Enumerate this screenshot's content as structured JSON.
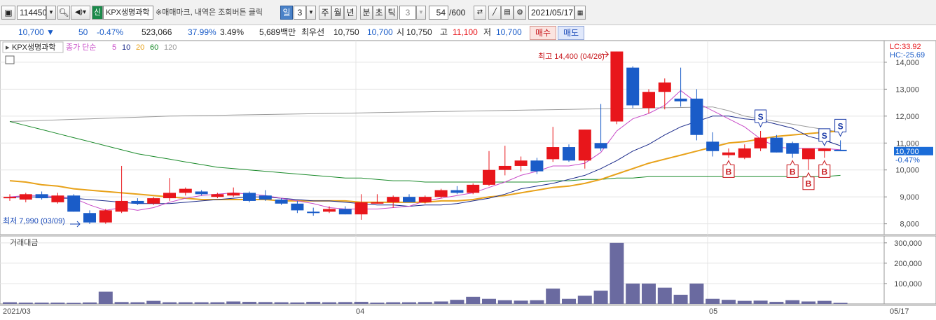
{
  "toolbar": {
    "code": "114450",
    "stock_badge": "신",
    "stock_name": "KPX생명과학",
    "notice": "※매매마크, 내역은 조회버튼 클릭",
    "period_selected": "일",
    "period_value": "3",
    "periods": [
      "주",
      "월",
      "년",
      "분",
      "초",
      "틱"
    ],
    "tick_value": "3",
    "count_value": "54",
    "count_total": "/600",
    "date": "2021/05/17"
  },
  "info": {
    "price": "10,700",
    "price_arrow": "▼",
    "change": "50",
    "change_pct": "-0.47%",
    "volume": "523,066",
    "vol_ratio": "37.99%",
    "turnover_pct": "3.49%",
    "amount": "5,689백만",
    "best_ask_label": "최우선",
    "best_ask": "10,750",
    "best_bid": "10,700",
    "open_label": "시",
    "open": "10,750",
    "high_label": "고",
    "high": "11,100",
    "low_label": "저",
    "low": "10,700",
    "buy_label": "매수",
    "sell_label": "매도"
  },
  "chart_labels": {
    "title": "KPX생명과학",
    "ma_label": "종가 단순",
    "ma_periods": [
      "5",
      "10",
      "20",
      "60",
      "120"
    ],
    "lc": "LC:33.92",
    "hc": "HC:-25.69",
    "high_marker": "최고 14,400 (04/26)",
    "low_marker": "최저 7,990 (03/09)",
    "last_price": "10,700",
    "last_change": "-0.47%",
    "volume_title": "거래대금"
  },
  "colors": {
    "up": "#e8161b",
    "down": "#1a5cc8",
    "ma5": "#c84bc8",
    "ma10": "#1a2a8a",
    "ma20": "#e8a21a",
    "ma60": "#1a8a2a",
    "ma120": "#9a9a9a",
    "volume": "#6a6aa0"
  },
  "chart_data": {
    "type": "candlestick",
    "ylim": [
      7600,
      14700
    ],
    "y_ticks": [
      "14,000",
      "13,000",
      "12,000",
      "11,000",
      "10,000",
      "9,000",
      "8,000"
    ],
    "y_tick_values": [
      14000,
      13000,
      12000,
      11000,
      10000,
      9000,
      8000
    ],
    "x_labels": [
      "2021/03",
      "04",
      "05",
      "05/17"
    ],
    "candles": [
      {
        "o": 8950,
        "h": 9100,
        "l": 8850,
        "c": 9000
      },
      {
        "o": 8900,
        "h": 9150,
        "l": 8800,
        "c": 9100
      },
      {
        "o": 9100,
        "h": 9200,
        "l": 8900,
        "c": 8950
      },
      {
        "o": 8800,
        "h": 9150,
        "l": 8750,
        "c": 9050
      },
      {
        "o": 9050,
        "h": 9100,
        "l": 8450,
        "c": 8450
      },
      {
        "o": 8400,
        "h": 8500,
        "l": 7990,
        "c": 8050
      },
      {
        "o": 8050,
        "h": 8550,
        "l": 8000,
        "c": 8500
      },
      {
        "o": 8450,
        "h": 10150,
        "l": 8400,
        "c": 8850
      },
      {
        "o": 8850,
        "h": 8950,
        "l": 8700,
        "c": 8750
      },
      {
        "o": 8750,
        "h": 9000,
        "l": 8700,
        "c": 8950
      },
      {
        "o": 8950,
        "h": 9700,
        "l": 8850,
        "c": 9150
      },
      {
        "o": 9150,
        "h": 9350,
        "l": 9050,
        "c": 9300
      },
      {
        "o": 9200,
        "h": 9250,
        "l": 9050,
        "c": 9100
      },
      {
        "o": 9000,
        "h": 9150,
        "l": 8950,
        "c": 9100
      },
      {
        "o": 9050,
        "h": 9350,
        "l": 9000,
        "c": 9150
      },
      {
        "o": 9150,
        "h": 9200,
        "l": 8800,
        "c": 8850
      },
      {
        "o": 9050,
        "h": 9250,
        "l": 8850,
        "c": 8900
      },
      {
        "o": 8900,
        "h": 8950,
        "l": 8700,
        "c": 8750
      },
      {
        "o": 8750,
        "h": 8850,
        "l": 8400,
        "c": 8500
      },
      {
        "o": 8450,
        "h": 8600,
        "l": 8300,
        "c": 8400
      },
      {
        "o": 8450,
        "h": 8650,
        "l": 8400,
        "c": 8550
      },
      {
        "o": 8550,
        "h": 8650,
        "l": 8350,
        "c": 8350
      },
      {
        "o": 8350,
        "h": 9100,
        "l": 8150,
        "c": 8800
      },
      {
        "o": 8800,
        "h": 9100,
        "l": 8750,
        "c": 8800
      },
      {
        "o": 8800,
        "h": 9050,
        "l": 8600,
        "c": 9000
      },
      {
        "o": 9000,
        "h": 9100,
        "l": 8800,
        "c": 8800
      },
      {
        "o": 8800,
        "h": 9050,
        "l": 8750,
        "c": 9000
      },
      {
        "o": 9000,
        "h": 9300,
        "l": 8950,
        "c": 9250
      },
      {
        "o": 9250,
        "h": 9400,
        "l": 9100,
        "c": 9150
      },
      {
        "o": 9150,
        "h": 9500,
        "l": 9100,
        "c": 9450
      },
      {
        "o": 9450,
        "h": 10700,
        "l": 9400,
        "c": 10000
      },
      {
        "o": 10000,
        "h": 10900,
        "l": 9800,
        "c": 10150
      },
      {
        "o": 10150,
        "h": 10500,
        "l": 9950,
        "c": 10350
      },
      {
        "o": 10350,
        "h": 10450,
        "l": 9850,
        "c": 9950
      },
      {
        "o": 10400,
        "h": 11600,
        "l": 10300,
        "c": 10850
      },
      {
        "o": 10850,
        "h": 10950,
        "l": 10300,
        "c": 10350
      },
      {
        "o": 10350,
        "h": 11500,
        "l": 10050,
        "c": 11500
      },
      {
        "o": 11000,
        "h": 12450,
        "l": 10700,
        "c": 10800
      },
      {
        "o": 11800,
        "h": 14400,
        "l": 11700,
        "c": 14400
      },
      {
        "o": 13800,
        "h": 13850,
        "l": 12300,
        "c": 12400
      },
      {
        "o": 12300,
        "h": 13000,
        "l": 12100,
        "c": 12900
      },
      {
        "o": 12900,
        "h": 13400,
        "l": 12250,
        "c": 13250
      },
      {
        "o": 12650,
        "h": 13800,
        "l": 12350,
        "c": 12550
      },
      {
        "o": 12650,
        "h": 13000,
        "l": 11100,
        "c": 11300
      },
      {
        "o": 11050,
        "h": 11400,
        "l": 10500,
        "c": 10700
      },
      {
        "o": 10550,
        "h": 10800,
        "l": 10450,
        "c": 10650
      },
      {
        "o": 10450,
        "h": 10950,
        "l": 10400,
        "c": 10800
      },
      {
        "o": 10800,
        "h": 11450,
        "l": 10700,
        "c": 11200
      },
      {
        "o": 11200,
        "h": 11300,
        "l": 10650,
        "c": 10650
      },
      {
        "o": 11000,
        "h": 11050,
        "l": 10450,
        "c": 10600
      },
      {
        "o": 10400,
        "h": 10800,
        "l": 10000,
        "c": 10800
      },
      {
        "o": 10700,
        "h": 10750,
        "l": 10450,
        "c": 10800
      },
      {
        "o": 10750,
        "h": 11100,
        "l": 10700,
        "c": 10700
      }
    ],
    "ma5": [
      9000,
      9050,
      9050,
      9000,
      8950,
      8700,
      8500,
      8600,
      8500,
      8600,
      8800,
      8950,
      9050,
      9100,
      9150,
      9100,
      9050,
      8950,
      8850,
      8750,
      8600,
      8550,
      8550,
      8550,
      8600,
      8650,
      8850,
      8950,
      9050,
      9150,
      9350,
      9550,
      9800,
      9950,
      10150,
      10150,
      10250,
      10650,
      11450,
      11900,
      12100,
      12400,
      12950,
      12500,
      12200,
      11900,
      11600,
      11150,
      10850,
      10800,
      10800,
      10800,
      10750
    ],
    "ma10": [
      9000,
      9000,
      9000,
      8950,
      8950,
      8900,
      8850,
      8800,
      8750,
      8750,
      8750,
      8800,
      8850,
      8900,
      8950,
      9000,
      9000,
      8950,
      8900,
      8850,
      8850,
      8800,
      8750,
      8700,
      8700,
      8650,
      8700,
      8700,
      8750,
      8850,
      8950,
      9100,
      9300,
      9400,
      9500,
      9650,
      9800,
      10050,
      10350,
      10700,
      10950,
      11300,
      11600,
      11800,
      12000,
      12000,
      11900,
      11850,
      11700,
      11550,
      11250,
      11100,
      10900
    ],
    "ma20": [
      9600,
      9550,
      9450,
      9400,
      9300,
      9250,
      9200,
      9150,
      9100,
      9050,
      9000,
      8950,
      8900,
      8900,
      8900,
      8900,
      8900,
      8850,
      8850,
      8850,
      8850,
      8850,
      8800,
      8800,
      8800,
      8800,
      8800,
      8850,
      8850,
      8900,
      9000,
      9050,
      9150,
      9250,
      9350,
      9400,
      9500,
      9650,
      9850,
      10050,
      10250,
      10400,
      10550,
      10700,
      10850,
      11000,
      11050,
      11150,
      11250,
      11300,
      11350,
      11400,
      11450
    ],
    "ma60": [
      11800,
      11650,
      11500,
      11350,
      11200,
      11050,
      10900,
      10750,
      10600,
      10500,
      10400,
      10300,
      10200,
      10100,
      10050,
      10000,
      9950,
      9900,
      9850,
      9800,
      9750,
      9700,
      9700,
      9650,
      9600,
      9600,
      9550,
      9550,
      9550,
      9550,
      9550,
      9550,
      9550,
      9550,
      9600,
      9600,
      9650,
      9650,
      9700,
      9700,
      9750,
      9750,
      9750,
      9750,
      9750,
      9750,
      9750,
      9750,
      9750,
      9750,
      9750,
      9750,
      9800
    ],
    "ma120": [
      11800,
      11820,
      11840,
      11860,
      11880,
      11900,
      11920,
      11940,
      11960,
      11980,
      12000,
      12010,
      12020,
      12030,
      12040,
      12050,
      12060,
      12070,
      12080,
      12090,
      12100,
      12110,
      12120,
      12130,
      12140,
      12150,
      12160,
      12170,
      12180,
      12190,
      12200,
      12210,
      12220,
      12230,
      12240,
      12250,
      12260,
      12270,
      12280,
      12290,
      12300,
      12310,
      12320,
      12330,
      12340,
      12200,
      12000,
      11900,
      11800,
      11700,
      11600,
      11500,
      11400
    ],
    "volume": [
      8000,
      6000,
      6000,
      6000,
      5000,
      7000,
      60000,
      9000,
      8000,
      15000,
      8000,
      8000,
      8000,
      8000,
      12000,
      10000,
      9000,
      8000,
      7000,
      10000,
      8000,
      9000,
      10000,
      6000,
      8000,
      8000,
      9000,
      12000,
      20000,
      35000,
      25000,
      18000,
      16000,
      18000,
      75000,
      25000,
      40000,
      65000,
      300000,
      100000,
      100000,
      80000,
      45000,
      100000,
      25000,
      20000,
      15000,
      16000,
      10000,
      18000,
      12000,
      15000,
      5000
    ],
    "volume_ylim": [
      0,
      320000
    ],
    "volume_ticks": [
      "300,000",
      "200,000",
      "100,000"
    ],
    "volume_tick_values": [
      300000,
      200000,
      100000
    ],
    "sell_marks": [
      47,
      51,
      52
    ],
    "buy_marks": [
      45,
      49,
      50,
      51
    ]
  }
}
